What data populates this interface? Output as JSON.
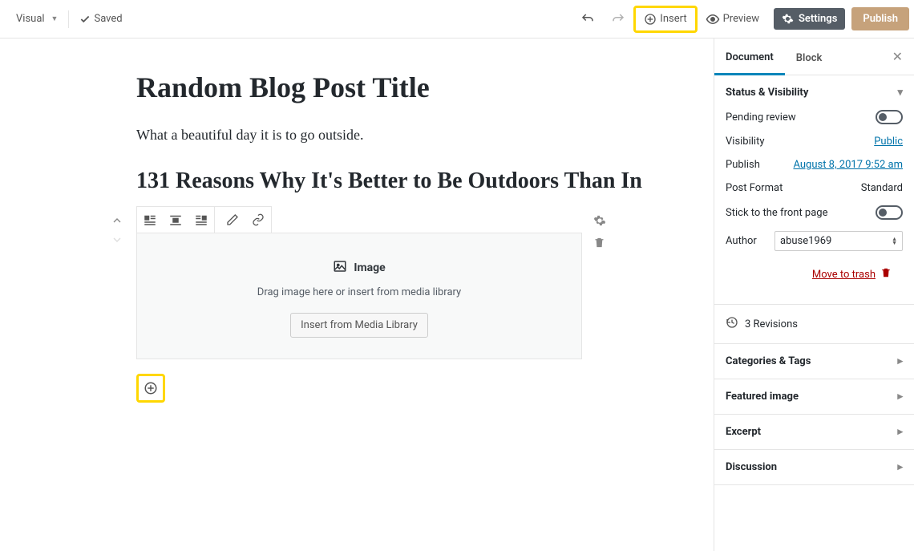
{
  "topbar": {
    "visual": "Visual",
    "saved": "Saved",
    "insert": "Insert",
    "preview": "Preview",
    "settings": "Settings",
    "publish": "Publish"
  },
  "post": {
    "title": "Random Blog Post Title",
    "paragraph": "What a beautiful day it is to go outside.",
    "heading": "131 Reasons Why It's Better to Be Outdoors Than In"
  },
  "imageBlock": {
    "label": "Image",
    "hint": "Drag image here or insert from media library",
    "insert_btn": "Insert from Media Library"
  },
  "sidebar": {
    "tabs": {
      "document": "Document",
      "block": "Block"
    },
    "status": {
      "title": "Status & Visibility",
      "pending": "Pending review",
      "visibility_label": "Visibility",
      "visibility_value": "Public",
      "publish_label": "Publish",
      "publish_value": "August 8, 2017 9:52 am",
      "post_format_label": "Post Format",
      "post_format_value": "Standard",
      "stick": "Stick to the front page",
      "author_label": "Author",
      "author_value": "abuse1969",
      "trash": "Move to trash"
    },
    "revisions": "3 Revisions",
    "categories": "Categories & Tags",
    "featured": "Featured image",
    "excerpt": "Excerpt",
    "discussion": "Discussion"
  }
}
